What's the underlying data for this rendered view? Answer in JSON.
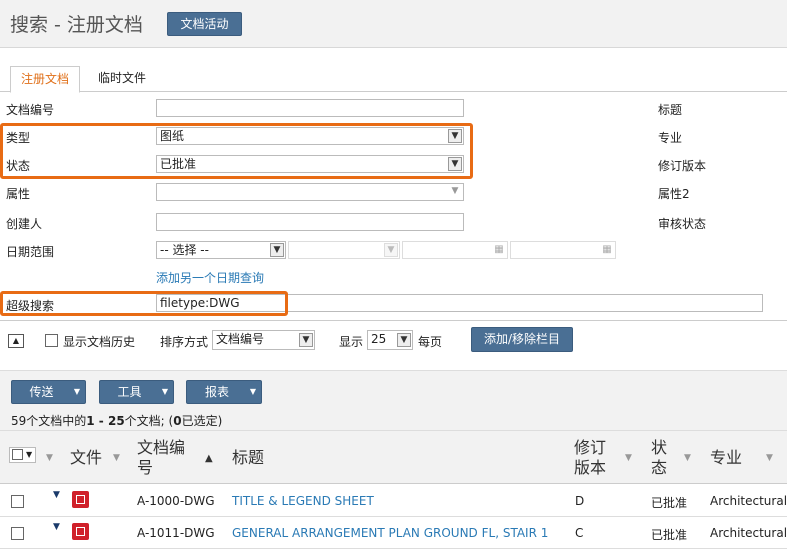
{
  "header": {
    "title": "搜索 - 注册文档",
    "activity_button": "文档活动"
  },
  "tabs": [
    {
      "label": "注册文档",
      "active": true
    },
    {
      "label": "临时文件",
      "active": false
    }
  ],
  "form": {
    "doc_number_label": "文档编号",
    "type_label": "类型",
    "type_value": "图纸",
    "status_label": "状态",
    "status_value": "已批准",
    "attribute_label": "属性",
    "creator_label": "创建人",
    "date_range_label": "日期范围",
    "date_select_value": "-- 选择 --",
    "add_date_link": "添加另一个日期查询",
    "super_search_label": "超级搜索",
    "super_search_value": "filetype:DWG",
    "right_labels": [
      "标题",
      "专业",
      "修订版本",
      "属性2",
      "审核状态"
    ]
  },
  "options": {
    "show_history_label": "显示文档历史",
    "sort_label": "排序方式",
    "sort_value": "文档编号",
    "display_label": "显示",
    "display_value": "25",
    "per_page_label": "每页",
    "columns_button": "添加/移除栏目"
  },
  "results": {
    "buttons": [
      "传送",
      "工具",
      "报表"
    ],
    "count_prefix": "59个文档中的",
    "count_range": "1 - 25",
    "count_mid": "个文档; (",
    "count_selected": "0",
    "count_suffix": "已选定)"
  },
  "table": {
    "headers": {
      "file": "文件",
      "doc_number_1": "文档编",
      "doc_number_2": "号",
      "title": "标题",
      "revision_1": "修订",
      "revision_2": "版本",
      "status_1": "状",
      "status_2": "态",
      "discipline": "专业"
    },
    "rows": [
      {
        "doc_number": "A-1000-DWG",
        "title": "TITLE & LEGEND SHEET",
        "revision": "D",
        "status": "已批准",
        "discipline": "Architectural"
      },
      {
        "doc_number": "A-1011-DWG",
        "title": "GENERAL ARRANGEMENT PLAN GROUND FL, STAIR 1",
        "revision": "C",
        "status": "已批准",
        "discipline": "Architectural"
      }
    ]
  },
  "colors": {
    "accent_orange": "#e86b14",
    "button_blue": "#4a6f94",
    "link_blue": "#2a7ab5",
    "file_icon_red": "#d0202a"
  },
  "icons": [
    "dropdown-arrow-icon",
    "calendar-icon",
    "expand-icon",
    "sort-asc-icon",
    "dwg-file-icon"
  ]
}
